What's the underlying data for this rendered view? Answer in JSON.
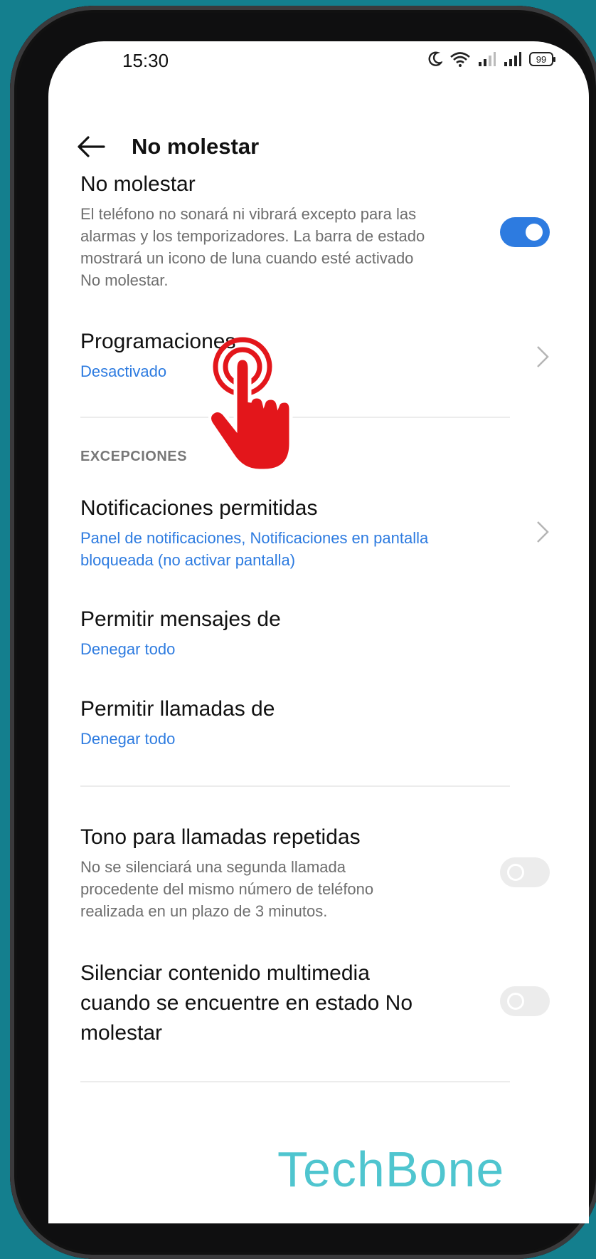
{
  "status_bar": {
    "time": "15:30",
    "battery": "99"
  },
  "header": {
    "title": "No molestar"
  },
  "dnd": {
    "title": "No molestar",
    "description": "El teléfono no sonará ni vibrará excepto para las alarmas y los temporizadores. La barra de estado mostrará un icono de luna cuando esté activado No molestar.",
    "enabled": true
  },
  "schedules": {
    "title": "Programaciones",
    "value": "Desactivado"
  },
  "exceptions": {
    "section_label": "EXCEPCIONES",
    "allowed_notifications": {
      "title": "Notificaciones permitidas",
      "value": "Panel de notificaciones, Notificaciones en pantalla bloqueada (no activar pantalla)"
    },
    "allow_messages": {
      "title": "Permitir mensajes de",
      "value": "Denegar todo"
    },
    "allow_calls": {
      "title": "Permitir llamadas de",
      "value": "Denegar todo"
    }
  },
  "repeat_calls": {
    "title": "Tono para llamadas repetidas",
    "description": "No se silenciará una segunda llamada procedente del mismo número de teléfono realizada en un plazo de 3 minutos.",
    "enabled": false
  },
  "mute_media": {
    "title": "Silenciar contenido multimedia cuando se encuentre en estado No molestar",
    "enabled": false
  },
  "watermark": "TechBone",
  "colors": {
    "accent": "#2d7be0",
    "hand": "#e3161b",
    "background": "#147f8e"
  },
  "icons": [
    "moon-icon",
    "wifi-icon",
    "signal-icon",
    "battery-icon",
    "back-arrow-icon",
    "chevron-right-icon",
    "tap-hand-icon"
  ]
}
